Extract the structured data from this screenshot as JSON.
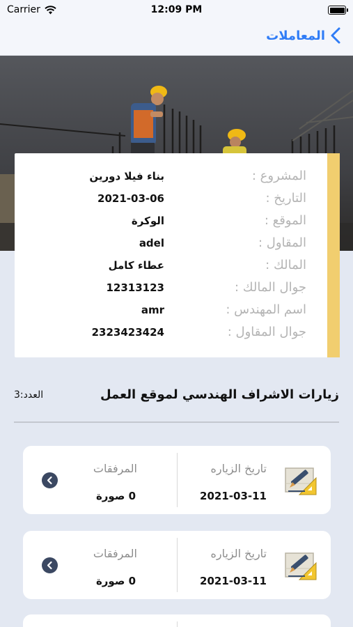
{
  "status_bar": {
    "carrier": "Carrier",
    "time": "12:09 PM"
  },
  "nav": {
    "back_label": "المعاملات"
  },
  "project": {
    "rows": [
      {
        "label": "المشروع :",
        "value": "بناء فيلا دورين"
      },
      {
        "label": "التاريخ :",
        "value": "2021-03-06"
      },
      {
        "label": "الموقع :",
        "value": "الوكرة"
      },
      {
        "label": "المقاول :",
        "value": "adel"
      },
      {
        "label": "المالك :",
        "value": "عطاء كامل"
      },
      {
        "label": "جوال المالك :",
        "value": "12313123"
      },
      {
        "label": "اسم المهندس :",
        "value": "amr"
      },
      {
        "label": "جوال المقاول :",
        "value": "2323423424"
      }
    ]
  },
  "visits": {
    "title": "زيارات الاشراف الهندسي لموقع العمل",
    "count": "العدد:3",
    "items": [
      {
        "date_label": "تاريخ الزياره",
        "date": "2021-03-11",
        "attachments_label": "المرفقات",
        "attachments": "0 صورة"
      },
      {
        "date_label": "تاريخ الزياره",
        "date": "2021-03-11",
        "attachments_label": "المرفقات",
        "attachments": "0 صورة"
      },
      {
        "date_label": "",
        "date": "",
        "attachments_label": "",
        "attachments": ""
      }
    ]
  },
  "colors": {
    "accent": "#2f7cf6",
    "card_accent": "#f1ce6f",
    "chevron_bg": "#3b4862",
    "background": "#e3e8f2"
  },
  "icons": {
    "back": "chevron-left-icon",
    "visit": "pencil-ruler-icon",
    "open": "chevron-right-circle-icon"
  }
}
